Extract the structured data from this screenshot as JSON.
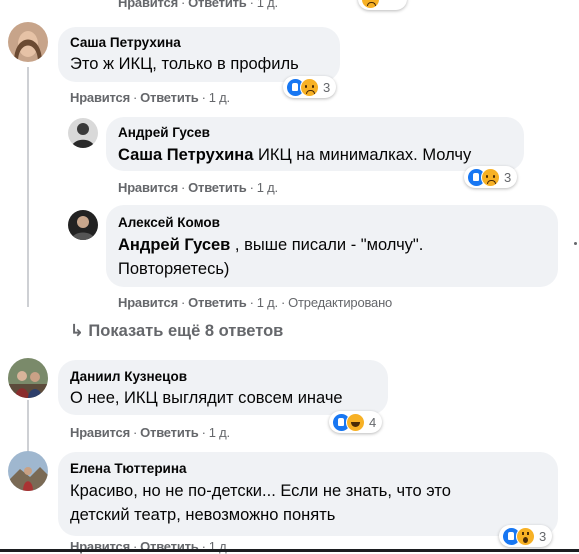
{
  "actions": {
    "like": "Нравится",
    "reply": "Ответить",
    "sep": "·",
    "edited": "Отредактировано"
  },
  "top_partial": {
    "time": "1 д."
  },
  "comments": [
    {
      "author": "Саша Петрухина",
      "text": "Это ж ИКЦ, только в профиль",
      "time": "1 д.",
      "reactions": {
        "types": [
          "like",
          "sad"
        ],
        "count": "3"
      }
    },
    {
      "author": "Андрей Гусев",
      "mention": "Саша Петрухина",
      "text": " ИКЦ на минималках. Молчу",
      "time": "1 д.",
      "reactions": {
        "types": [
          "like",
          "sad"
        ],
        "count": "3"
      }
    },
    {
      "author": "Алексей Комов",
      "mention": "Андрей Гусев",
      "text_line1": " , выше писали - \"молчу\".",
      "text_line2": "Повторяетесь)",
      "time": "1 д."
    },
    {
      "author": "Даниил Кузнецов",
      "text": "О нее, ИКЦ выглядит совсем иначе",
      "time": "1 д.",
      "reactions": {
        "types": [
          "like",
          "laugh"
        ],
        "count": "4"
      }
    },
    {
      "author": "Елена Тюттерина",
      "text_line1": "Красиво, но не по-детски... Если не знать, что это",
      "text_line2": "детский театр, невозможно понять",
      "time": "1 д.",
      "reactions": {
        "types": [
          "like",
          "wow"
        ],
        "count": "3"
      }
    }
  ],
  "show_more": {
    "arrow": "↳",
    "label": "Показать ещё 8 ответов"
  }
}
